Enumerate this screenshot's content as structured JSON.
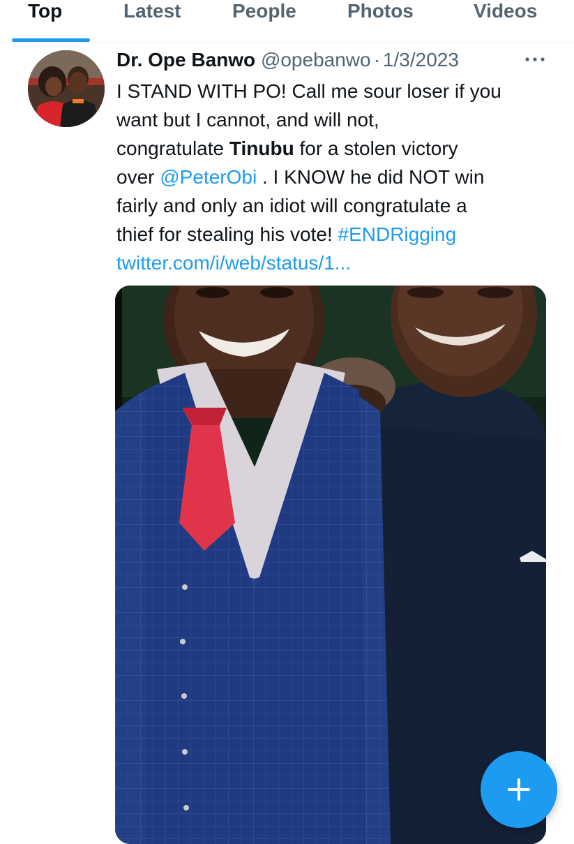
{
  "tabs": [
    {
      "label": "Top",
      "active": true
    },
    {
      "label": "Latest",
      "active": false
    },
    {
      "label": "People",
      "active": false
    },
    {
      "label": "Photos",
      "active": false
    },
    {
      "label": "Videos",
      "active": false
    }
  ],
  "tweet": {
    "author_name": "Dr. Ope Banwo",
    "handle": "@opebanwo",
    "separator": "·",
    "date": "1/3/2023",
    "text_parts": {
      "p1": "I STAND WITH PO! Call me sour loser if you",
      "p2": "want but I cannot, and will not,",
      "p3a": "congratulate ",
      "p3_bold": "Tinubu",
      "p3b": " for a stolen victory",
      "p4a": "over ",
      "p4_mention": "@PeterObi",
      "p4b": " . I KNOW he did NOT win",
      "p5": "fairly and only an idiot will congratulate a",
      "p6a": "thief for stealing his vote! ",
      "p6_hashtag": "#ENDRigging",
      "p7_link": "twitter.com/i/web/status/1..."
    },
    "more_icon": "more-horizontal-icon",
    "media_description_icon": "photo"
  },
  "fab": {
    "icon": "plus-icon"
  },
  "colors": {
    "accent": "#1d9bf0",
    "text_primary": "#0f1419",
    "text_secondary": "#536471"
  }
}
